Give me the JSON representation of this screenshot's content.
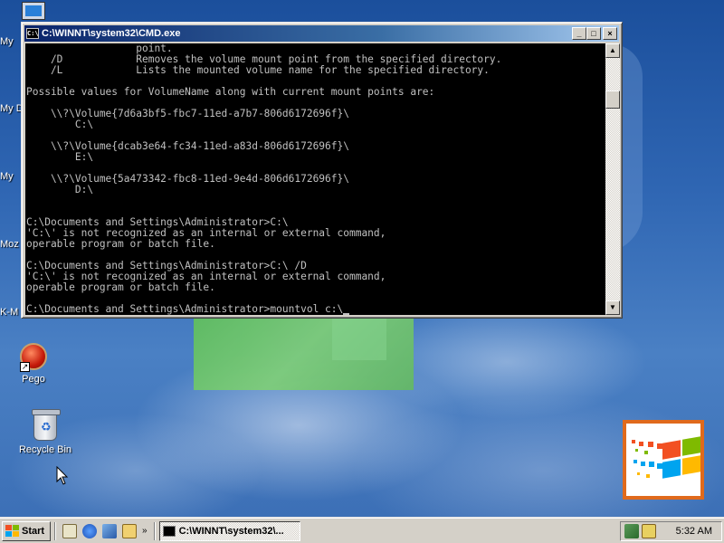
{
  "desktop": {
    "edge_labels": [
      "My",
      "My D",
      "My",
      "Moz",
      "K-M"
    ],
    "icons": [
      {
        "name": "pego",
        "label": "Pego"
      },
      {
        "name": "recycle-bin",
        "label": "Recycle Bin"
      }
    ],
    "colors": {
      "flag_red": "#f25022",
      "flag_green": "#7fba00",
      "flag_blue": "#00a4ef",
      "flag_yellow": "#ffb900",
      "flag_border": "#e06a1c"
    }
  },
  "window": {
    "title": "C:\\WINNT\\system32\\CMD.exe",
    "controls": {
      "minimize": "_",
      "maximize": "□",
      "close": "×"
    },
    "scroll_up": "▲",
    "scroll_down": "▼",
    "console_lines": [
      "                  point.",
      "    /D            Removes the volume mount point from the specified directory.",
      "    /L            Lists the mounted volume name for the specified directory.",
      "",
      "Possible values for VolumeName along with current mount points are:",
      "",
      "    \\\\?\\Volume{7d6a3bf5-fbc7-11ed-a7b7-806d6172696f}\\",
      "        C:\\",
      "",
      "    \\\\?\\Volume{dcab3e64-fc34-11ed-a83d-806d6172696f}\\",
      "        E:\\",
      "",
      "    \\\\?\\Volume{5a473342-fbc8-11ed-9e4d-806d6172696f}\\",
      "        D:\\",
      "",
      "",
      "C:\\Documents and Settings\\Administrator>C:\\",
      "'C:\\' is not recognized as an internal or external command,",
      "operable program or batch file.",
      "",
      "C:\\Documents and Settings\\Administrator>C:\\ /D",
      "'C:\\' is not recognized as an internal or external command,",
      "operable program or batch file.",
      ""
    ],
    "prompt_line": "C:\\Documents and Settings\\Administrator>mountvol c:\\"
  },
  "taskbar": {
    "start_label": "Start",
    "quicklaunch_more": "»",
    "task_label": "C:\\WINNT\\system32\\...",
    "clock": "5:32 AM"
  }
}
